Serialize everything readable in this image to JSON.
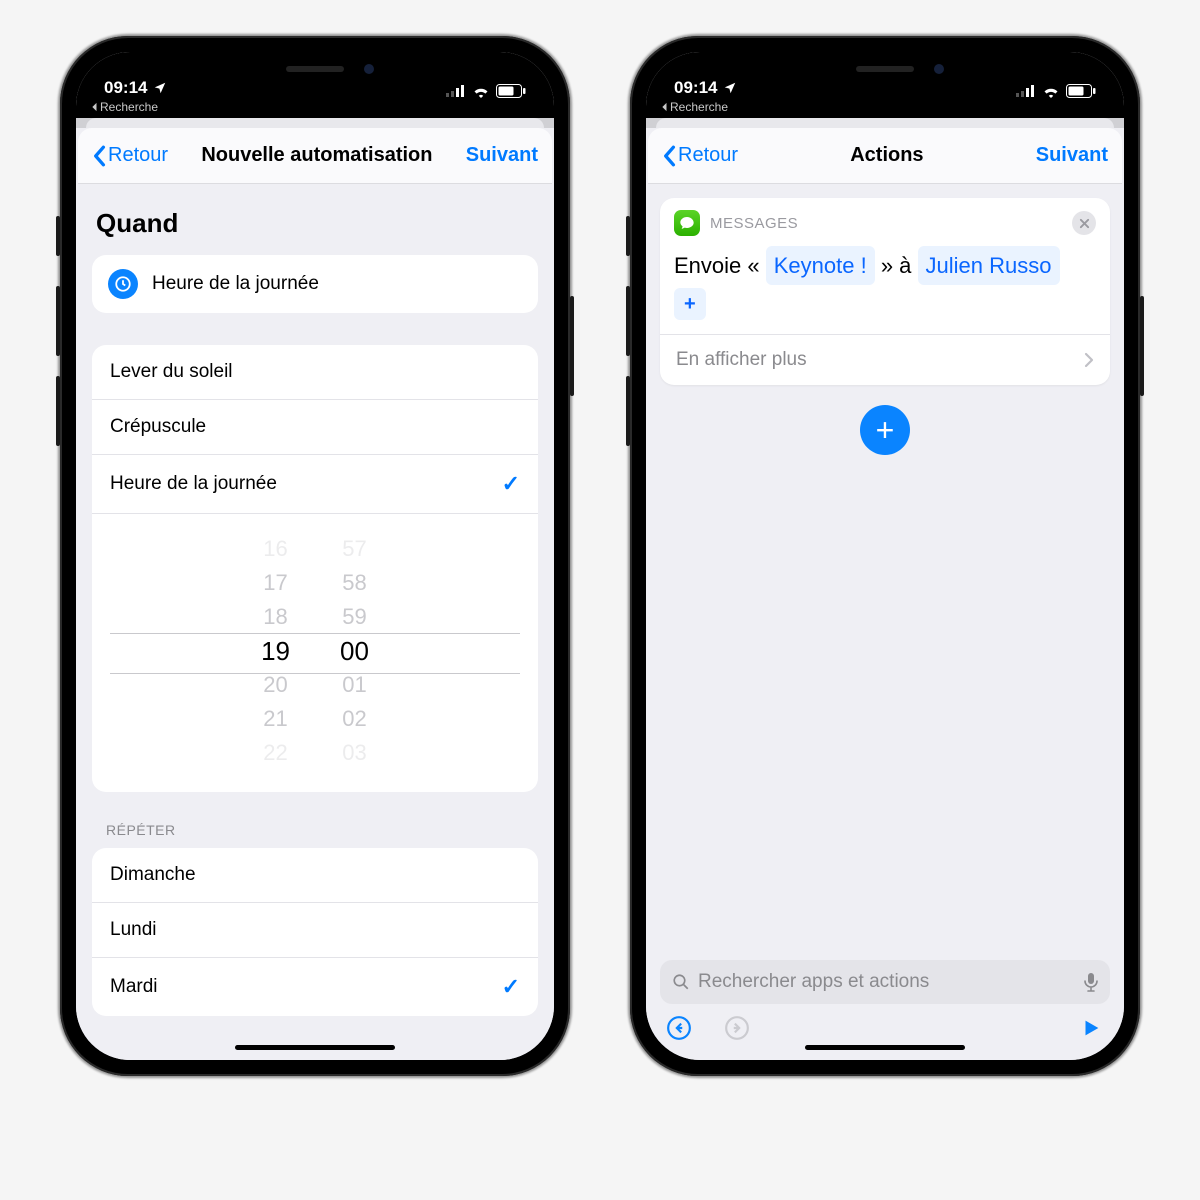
{
  "status": {
    "time": "09:14",
    "breadcrumb_label": "Recherche"
  },
  "left": {
    "nav_back": "Retour",
    "nav_title": "Nouvelle automatisation",
    "nav_next": "Suivant",
    "section": "Quand",
    "pill": "Heure de la journée",
    "options": {
      "sunrise": "Lever du soleil",
      "sunset": "Crépuscule",
      "timeofday": "Heure de la journée"
    },
    "picker_hours": [
      "16",
      "17",
      "18",
      "19",
      "20",
      "21",
      "22"
    ],
    "picker_minutes": [
      "57",
      "58",
      "59",
      "00",
      "01",
      "02",
      "03"
    ],
    "repeat_label": "RÉPÉTER",
    "days": {
      "sun": "Dimanche",
      "mon": "Lundi",
      "tue": "Mardi"
    }
  },
  "right": {
    "nav_back": "Retour",
    "nav_title": "Actions",
    "nav_next": "Suivant",
    "card_app": "MESSAGES",
    "send_prefix": "Envoie «",
    "send_message": "Keynote !",
    "send_mid": "» à",
    "send_recipient": "Julien Russo",
    "more": "En afficher plus",
    "search_placeholder": "Rechercher apps et actions"
  }
}
